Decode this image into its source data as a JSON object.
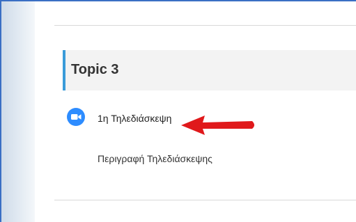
{
  "section": {
    "title": "Topic 3"
  },
  "activity": {
    "icon": "zoom-video-icon",
    "label": "1η Τηλεδιάσκεψη",
    "description": "Περιγραφή Τηλεδιάσκεψης"
  },
  "annotation": {
    "icon": "red-arrow-icon",
    "color": "#e0191b"
  },
  "colors": {
    "accent": "#3a9bd9",
    "zoom_blue": "#2d8cff",
    "window_border": "#3a6fc4"
  }
}
